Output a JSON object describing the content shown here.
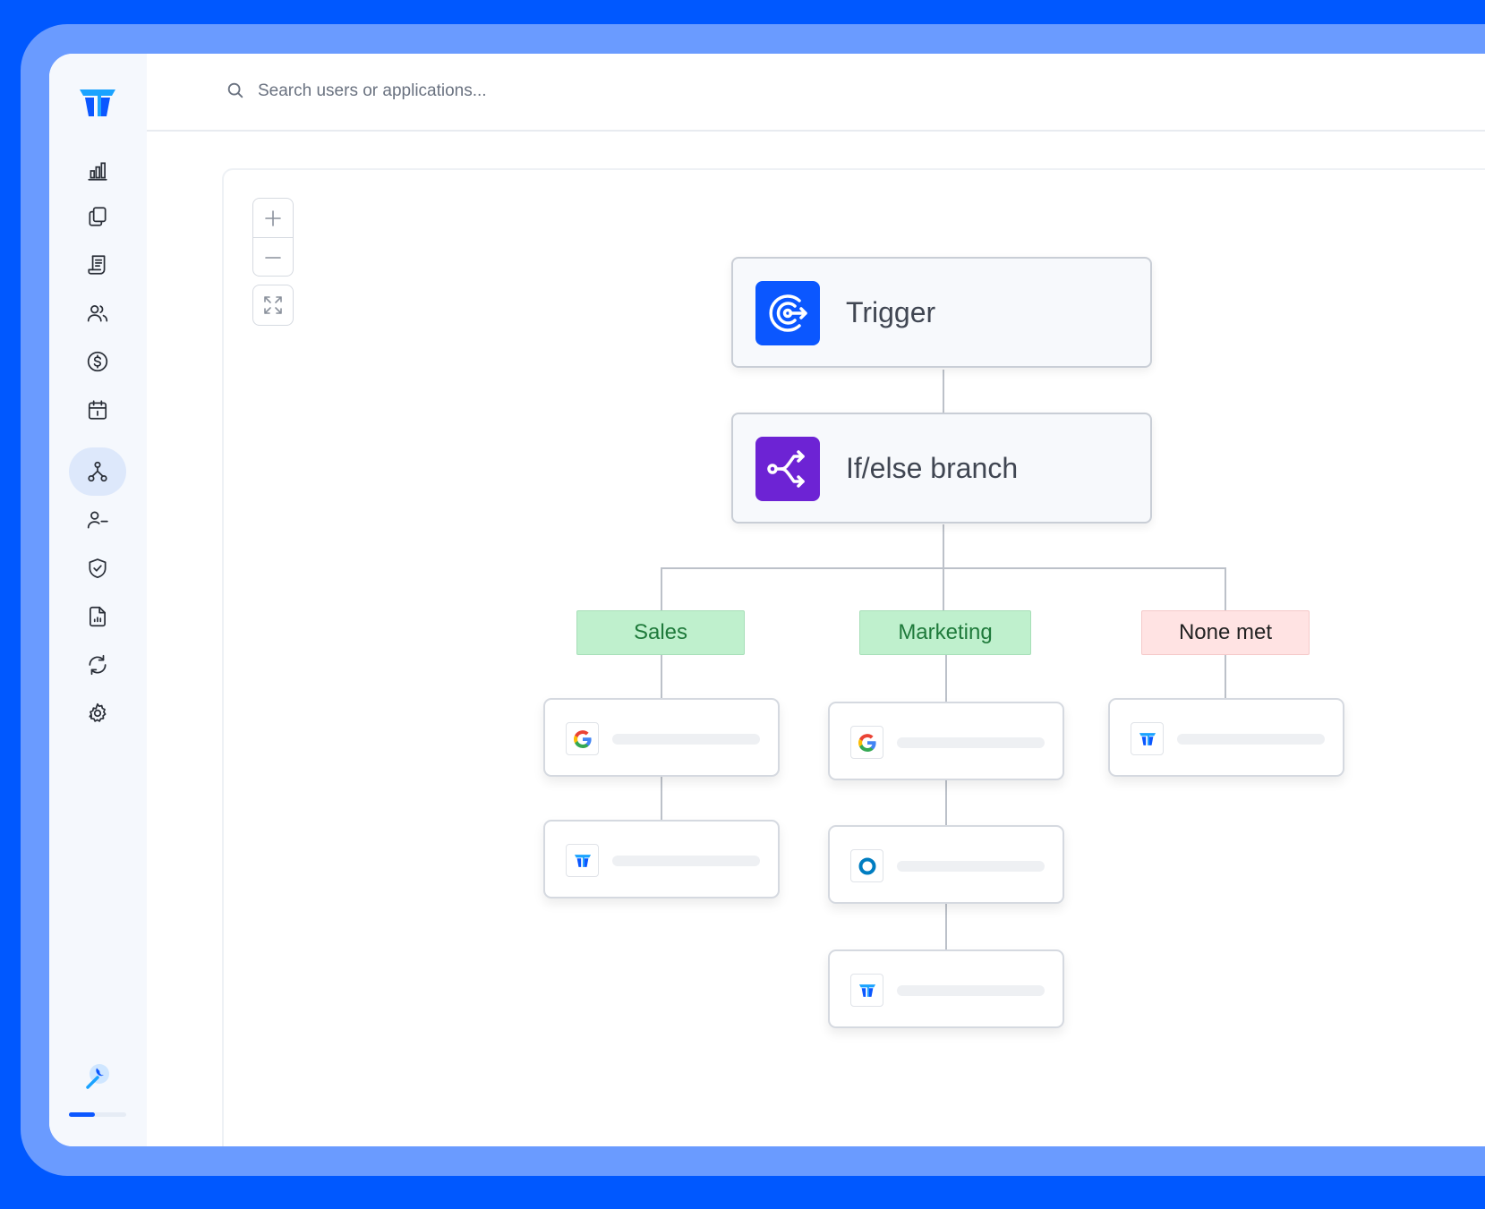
{
  "search": {
    "placeholder": "Search users or applications..."
  },
  "sidebar": {
    "items": [
      {
        "icon": "bar-chart-icon",
        "active": false
      },
      {
        "icon": "copy-icon",
        "active": false
      },
      {
        "icon": "receipt-icon",
        "active": false
      },
      {
        "icon": "users-icon",
        "active": false
      },
      {
        "icon": "dollar-icon",
        "active": false
      },
      {
        "icon": "calendar-icon",
        "active": false
      },
      {
        "icon": "workflow-icon",
        "active": true
      },
      {
        "icon": "user-minus-icon",
        "active": false
      },
      {
        "icon": "shield-check-icon",
        "active": false
      },
      {
        "icon": "report-icon",
        "active": false
      },
      {
        "icon": "refresh-icon",
        "active": false
      },
      {
        "icon": "gear-icon",
        "active": false
      }
    ],
    "progress_fraction": 0.45
  },
  "zoom": {
    "in_icon": "plus-icon",
    "out_icon": "minus-icon",
    "fit_icon": "fit-view-icon"
  },
  "workflow": {
    "trigger": {
      "label": "Trigger",
      "color": "#0b57ff",
      "icon": "trigger-icon"
    },
    "branch_node": {
      "label": "If/else branch",
      "color": "#6d23d4",
      "icon": "branch-icon"
    },
    "branches": [
      {
        "label": "Sales",
        "status": "matched",
        "apps": [
          "google-icon",
          "app-logo-icon"
        ]
      },
      {
        "label": "Marketing",
        "status": "matched",
        "apps": [
          "google-icon",
          "okta-icon",
          "app-logo-icon"
        ]
      },
      {
        "label": "None met",
        "status": "fallback",
        "apps": [
          "app-logo-icon"
        ]
      }
    ]
  },
  "colors": {
    "brand": "#0058ff",
    "frame": "#6a9bff",
    "matched_bg": "#bff0cd",
    "fallback_bg": "#ffe3e3"
  }
}
